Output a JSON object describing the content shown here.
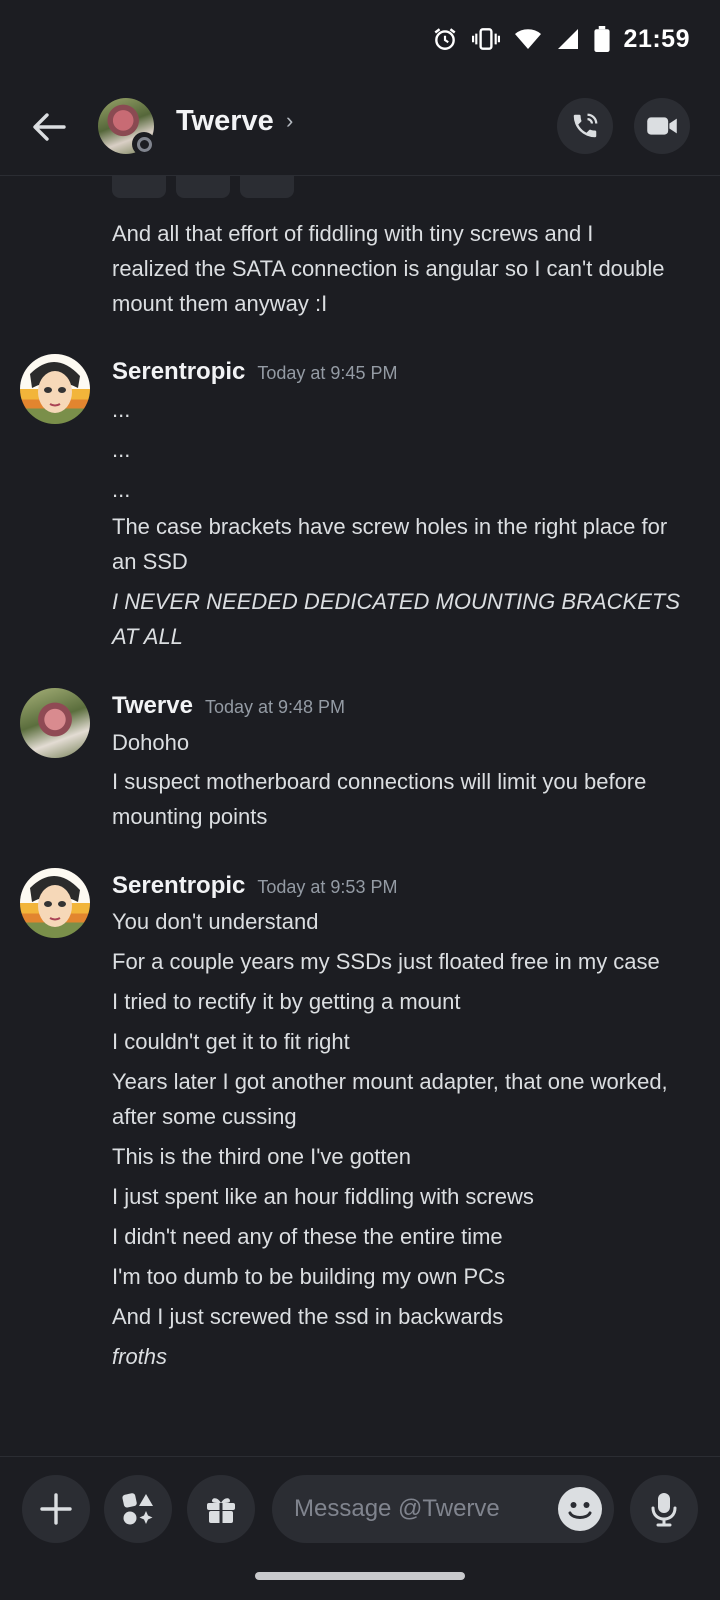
{
  "status_bar": {
    "time": "21:59"
  },
  "header": {
    "name": "Twerve",
    "chevron": "›"
  },
  "messages": {
    "m0": {
      "lines": [
        "And all that effort of fiddling with tiny screws and I",
        "realized the SATA connection is angular so I can't double",
        "mount them anyway :I"
      ]
    },
    "g1": {
      "author": "Serentropic",
      "timestamp": "Today at 9:45 PM",
      "l1": "...",
      "l2": "...",
      "l3": "...",
      "l4a": "The case brackets have screw holes in the right place for",
      "l4b": "an SSD",
      "l5a": "I NEVER NEEDED DEDICATED MOUNTING BRACKETS",
      "l5b": "AT ALL"
    },
    "g2": {
      "author": "Twerve",
      "timestamp": "Today at 9:48 PM",
      "l1": "Dohoho",
      "l2a": "I suspect motherboard connections will limit you before",
      "l2b": "mounting points"
    },
    "g3": {
      "author": "Serentropic",
      "timestamp": "Today at 9:53 PM",
      "l1": "You don't understand",
      "l2": "For a couple years my SSDs just floated free in my case",
      "l3": "I tried to rectify it by getting a mount",
      "l4": "I couldn't get it to fit right",
      "l5a": "Years later I got another mount adapter, that one worked,",
      "l5b": "after some cussing",
      "l6": "This is the third one I've gotten",
      "l7": "I just spent like an hour fiddling with screws",
      "l8": "I didn't need any of these the entire time",
      "l9": "I'm too dumb to be building my own PCs",
      "l10": "And I just screwed the ssd in backwards",
      "l11": "froths"
    }
  },
  "composer": {
    "placeholder": "Message @Twerve"
  },
  "icons": [
    "back-arrow-icon",
    "phone-call-icon",
    "video-camera-icon",
    "plus-icon",
    "apps-icon",
    "gift-icon",
    "emoji-icon",
    "microphone-icon",
    "alarm-icon",
    "vibrate-icon",
    "wifi-icon",
    "signal-icon",
    "battery-icon"
  ],
  "colors": {
    "background": "#1c1d22",
    "surface": "#2b2d33",
    "text": "#dbdee1",
    "muted": "#949ba4"
  }
}
